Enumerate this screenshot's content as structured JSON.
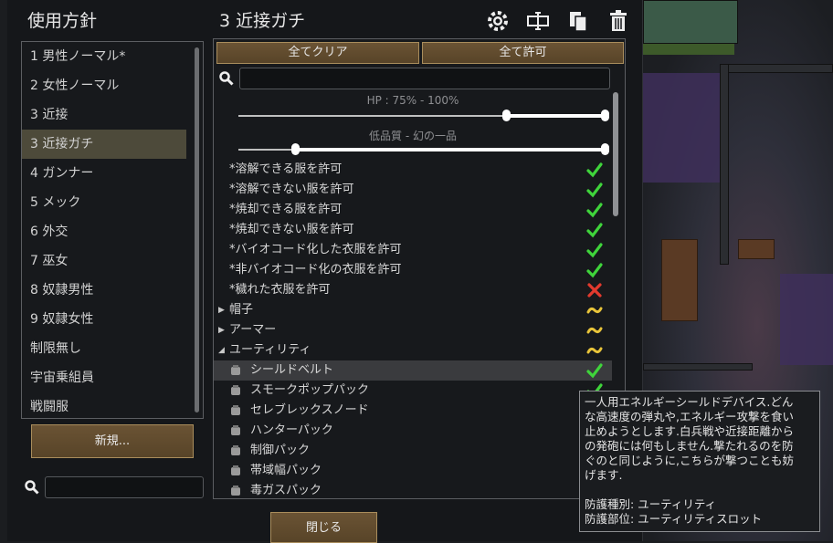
{
  "window": {
    "left_title": "使用方針",
    "right_title": "3 近接ガチ"
  },
  "toolbar": {
    "icons": [
      "gear-icon",
      "rename-icon",
      "copy-icon",
      "trash-icon"
    ]
  },
  "policies": {
    "items": [
      {
        "label": "1 男性ノーマル*"
      },
      {
        "label": "2 女性ノーマル"
      },
      {
        "label": "3 近接"
      },
      {
        "label": "3 近接ガチ"
      },
      {
        "label": "4 ガンナー"
      },
      {
        "label": "5 メック"
      },
      {
        "label": "6 外交"
      },
      {
        "label": "7 巫女"
      },
      {
        "label": "8 奴隷男性"
      },
      {
        "label": "9 奴隷女性"
      },
      {
        "label": "制限無し"
      },
      {
        "label": "宇宙乗組員"
      },
      {
        "label": "戦闘服"
      }
    ],
    "selected": "3 近接ガチ",
    "new_button": "新規...",
    "search_value": ""
  },
  "filter": {
    "clear_all": "全てクリア",
    "allow_all": "全て許可",
    "search_value": "",
    "hp_label": "HP : 75% - 100%",
    "hp_range": [
      0.75,
      1.0
    ],
    "quality_label": "低品質 - 幻の一品",
    "quality_range": [
      0,
      1
    ],
    "rows": [
      {
        "label": "*溶解できる服を許可",
        "state": "check"
      },
      {
        "label": "*溶解できない服を許可",
        "state": "check"
      },
      {
        "label": "*焼却できる服を許可",
        "state": "check"
      },
      {
        "label": "*焼却できない服を許可",
        "state": "check"
      },
      {
        "label": "*バイオコード化した衣服を許可",
        "state": "check"
      },
      {
        "label": "*非バイオコード化の衣服を許可",
        "state": "check"
      },
      {
        "label": "*穢れた衣服を許可",
        "state": "cross"
      },
      {
        "label": "帽子",
        "state": "partial",
        "arrow": "▶"
      },
      {
        "label": "アーマー",
        "state": "partial",
        "arrow": "▶"
      },
      {
        "label": "ユーティリティ",
        "state": "partial",
        "arrow": "◢"
      },
      {
        "label": "シールドベルト",
        "state": "check",
        "icon": "belt-icon"
      },
      {
        "label": "スモークポップパック",
        "state": "check",
        "icon": "pack-icon"
      },
      {
        "label": "セレブレックスノード",
        "state": "check",
        "icon": "node-icon"
      },
      {
        "label": "ハンターパック",
        "state": "check",
        "icon": "pack-icon"
      },
      {
        "label": "制御パック",
        "state": "check",
        "icon": "pack-icon"
      },
      {
        "label": "帯域幅パック",
        "state": "check",
        "icon": "pack-icon"
      },
      {
        "label": "毒ガスパック",
        "state": "check",
        "icon": "pack-icon"
      }
    ],
    "colors": {
      "check": "#3fd43b",
      "cross": "#e23a2e",
      "partial": "#e8c43a"
    }
  },
  "close_button": "閉じる",
  "tooltip": {
    "lines": [
      "一人用エネルギーシールドデバイス.どん",
      "な高速度の弾丸や,エネルギー攻撃を食い",
      "止めようとします.白兵戦や近接距離から",
      "の発砲には何もしません.撃たれるのを防",
      "ぐのと同じように,こちらが撃つことも妨",
      "げます."
    ],
    "type_line": "防護種別: ユーティリティ",
    "part_line": "防護部位: ユーティリティスロット"
  }
}
